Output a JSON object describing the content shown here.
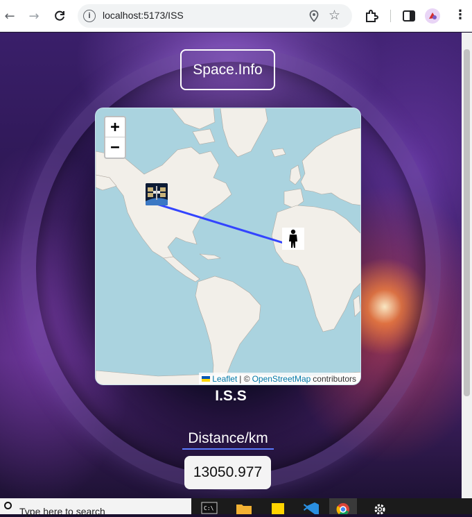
{
  "browser": {
    "url": "localhost:5173/ISS",
    "icons": [
      "back-arrow-icon",
      "forward-arrow-icon",
      "reload-icon",
      "site-info-icon",
      "location-pin-icon",
      "bookmark-star-icon",
      "extensions-icon",
      "side-panel-icon",
      "profile-icon",
      "menu-kebab-icon"
    ]
  },
  "page": {
    "site_title": "Space.Info",
    "satellite_label": "I.S.S",
    "distance_label": "Distance/km",
    "distance_value": "13050.977"
  },
  "map": {
    "zoom_in": "+",
    "zoom_out": "−",
    "attribution": {
      "leaflet": "Leaflet",
      "separator": "| ©",
      "osm": "OpenStreetMap",
      "suffix": "contributors"
    },
    "markers": [
      "iss-satellite-icon",
      "person-location-icon"
    ],
    "line_color": "#3344ff"
  },
  "taskbar": {
    "search_placeholder": "Type here to search",
    "apps": [
      "terminal-icon",
      "file-explorer-icon",
      "sticky-notes-icon",
      "vscode-icon",
      "chrome-icon",
      "settings-gear-icon"
    ]
  },
  "colors": {
    "accent_underline": "#5b7bff",
    "ocean": "#aad3df",
    "land": "#f2efe9"
  }
}
